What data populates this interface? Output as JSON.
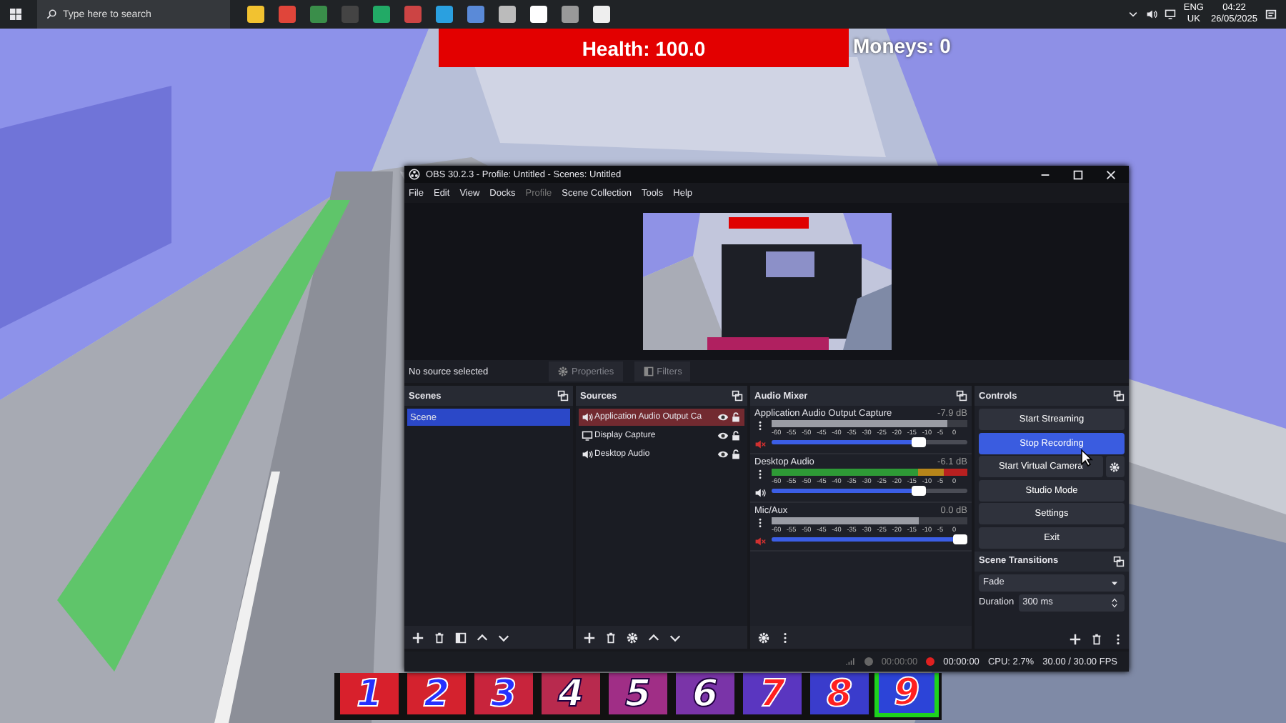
{
  "taskbar": {
    "search": {
      "placeholder": "Type here to search"
    },
    "language": "ENG",
    "region": "UK",
    "time": "04:22",
    "date": "26/05/2025"
  },
  "hud": {
    "health": "Health: 100.0",
    "money": "Moneys: 0"
  },
  "hotbar": [
    {
      "digit": "1",
      "color": "#d8202c",
      "selected": false
    },
    {
      "digit": "2",
      "color": "#d4222e",
      "selected": false
    },
    {
      "digit": "3",
      "color": "#c8243c",
      "selected": false
    },
    {
      "digit": "4",
      "color": "#b82a4e",
      "selected": false
    },
    {
      "digit": "5",
      "color": "#a02e86",
      "selected": false
    },
    {
      "digit": "6",
      "color": "#7a34a8",
      "selected": false
    },
    {
      "digit": "7",
      "color": "#5a36c0",
      "selected": false
    },
    {
      "digit": "8",
      "color": "#3a3ccc",
      "selected": false
    },
    {
      "digit": "9",
      "color": "#2c44d8",
      "selected": true
    }
  ],
  "obs": {
    "title": "OBS 30.2.3 - Profile: Untitled - Scenes: Untitled",
    "menu": [
      {
        "label": "File",
        "disabled": false
      },
      {
        "label": "Edit",
        "disabled": false
      },
      {
        "label": "View",
        "disabled": false
      },
      {
        "label": "Docks",
        "disabled": false
      },
      {
        "label": "Profile",
        "disabled": true
      },
      {
        "label": "Scene Collection",
        "disabled": false
      },
      {
        "label": "Tools",
        "disabled": false
      },
      {
        "label": "Help",
        "disabled": false
      }
    ],
    "no_source": "No source selected",
    "source_buttons": [
      {
        "label": "Properties",
        "kind": "gear",
        "disabled": true
      },
      {
        "label": "Filters",
        "kind": "filter",
        "disabled": true
      }
    ],
    "scenes": {
      "title": "Scenes",
      "items": [
        {
          "label": "Scene",
          "selected": true
        }
      ]
    },
    "sources": {
      "title": "Sources",
      "items": [
        {
          "label": "Application Audio Output Ca",
          "kind": "audio",
          "selected": true
        },
        {
          "label": "Display Capture",
          "kind": "display",
          "selected": false
        },
        {
          "label": "Desktop Audio",
          "kind": "audio",
          "selected": false
        }
      ]
    },
    "mixer": {
      "title": "Audio Mixer",
      "channels": [
        {
          "name": "Application Audio Output Capture",
          "reading": "-7.9 dB",
          "muted": true,
          "meter": {
            "level": 0.9
          },
          "volume": {
            "level": 0.77
          },
          "scale": [
            "-60",
            "-55",
            "-50",
            "-45",
            "-40",
            "-35",
            "-30",
            "-25",
            "-20",
            "-15",
            "-10",
            "-5",
            "0"
          ]
        },
        {
          "name": "Desktop Audio",
          "reading": "-6.1 dB",
          "muted": false,
          "meter": {
            "level": 1
          },
          "volume": {
            "level": 0.77
          },
          "scale": [
            "-60",
            "-55",
            "-50",
            "-45",
            "-40",
            "-35",
            "-30",
            "-25",
            "-20",
            "-15",
            "-10",
            "-5",
            "0"
          ]
        },
        {
          "name": "Mic/Aux",
          "reading": "0.0 dB",
          "muted": true,
          "meter": {
            "level": 0.75
          },
          "volume": {
            "level": 1
          },
          "scale": [
            "-60",
            "-55",
            "-50",
            "-45",
            "-40",
            "-35",
            "-30",
            "-25",
            "-20",
            "-15",
            "-10",
            "-5",
            "0"
          ]
        }
      ]
    },
    "controls": {
      "title": "Controls",
      "buttons": [
        {
          "label": "Start Streaming",
          "active": false,
          "kind": "plain"
        },
        {
          "label": "Stop Recording",
          "active": true,
          "kind": "plain"
        },
        {
          "label": "Start Virtual Camera",
          "active": false,
          "kind": "with_settings"
        },
        {
          "label": "Studio Mode",
          "active": false,
          "kind": "plain"
        },
        {
          "label": "Settings",
          "active": false,
          "kind": "plain"
        },
        {
          "label": "Exit",
          "active": false,
          "kind": "plain"
        }
      ]
    },
    "transitions": {
      "title": "Scene Transitions",
      "type": "Fade",
      "duration_label": "Duration",
      "duration": "300 ms"
    },
    "status": {
      "stream_time": "00:00:00",
      "record_time": "00:00:00",
      "recording": true,
      "cpu": "CPU: 2.7%",
      "fps": "30.00 / 30.00 FPS"
    }
  }
}
